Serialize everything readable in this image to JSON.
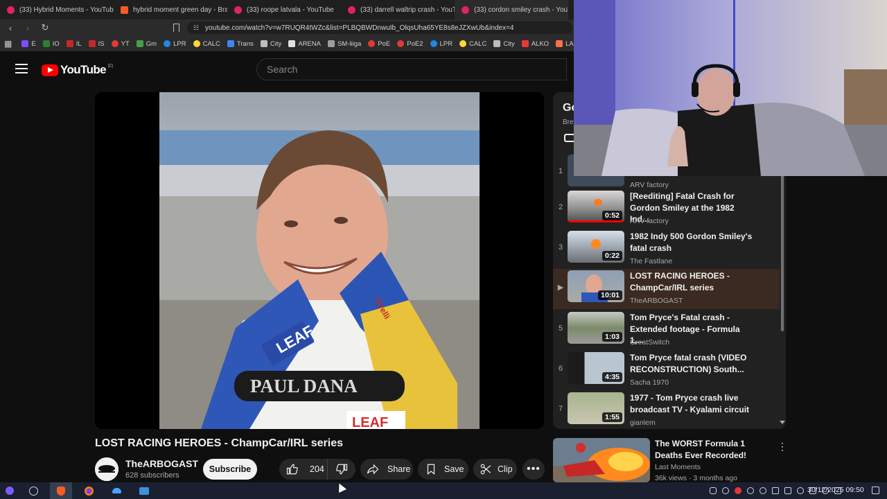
{
  "browser": {
    "tabs": [
      {
        "label": "(33) Hybrid Moments - YouTube",
        "icon": "youtube-favicon"
      },
      {
        "label": "hybrid moment green day - Brav",
        "icon": "brave-favicon"
      },
      {
        "label": "(33) roope latvala - YouTube",
        "icon": "youtube-favicon"
      },
      {
        "label": "(33) darrell waltrip crash - YouTu",
        "icon": "youtube-favicon"
      },
      {
        "label": "(33) cordon smiley crash - YouTu",
        "icon": "youtube-favicon"
      }
    ],
    "url": "youtube.com/watch?v=w7RUQR4tWZc&list=PLBQBWDnwuIb_OlqsUha65YE8s8eJZXwUb&index=4",
    "bookmarks": [
      "E",
      "IO",
      "IL",
      "IS",
      "YT",
      "Gm",
      "LPR",
      "CALC",
      "Trans",
      "City",
      "ARENA",
      "SM-liiga",
      "PoE",
      "PoE2",
      "LPR",
      "CALC",
      "City",
      "ALKO",
      "LA"
    ]
  },
  "youtube": {
    "logo_text": "YouTube",
    "country_code": "FI",
    "search_placeholder": "Search"
  },
  "video": {
    "title": "LOST RACING HEROES - ChampCar/IRL series",
    "overlay_caption": "PAUL DANA",
    "suit_text_1": "LEAF",
    "suit_text_2": "LEAF",
    "suit_text_3": "Pirelli",
    "channel": "TheARBOGAST",
    "subscribers": "628 subscribers",
    "subscribe_label": "Subscribe",
    "likes": "204",
    "share_label": "Share",
    "save_label": "Save",
    "clip_label": "Clip"
  },
  "playlist": {
    "header_partial": "Go",
    "sub_partial": "Bre",
    "items": [
      {
        "index": "1",
        "title": "",
        "channel": "ARV factory",
        "duration": ""
      },
      {
        "index": "2",
        "title": "[Reediting] Fatal Crash for Gordon Smiley at the 1982 Ind...",
        "channel": "ARV factory",
        "duration": "0:52"
      },
      {
        "index": "3",
        "title": "1982 Indy 500 Gordon Smiley's fatal crash",
        "channel": "The Fastlane",
        "duration": "0:22"
      },
      {
        "index": "▶",
        "title": "LOST RACING HEROES - ChampCar/IRL series",
        "channel": "TheARBOGAST",
        "duration": "10:01"
      },
      {
        "index": "5",
        "title": "Tom Pryce's Fatal crash - Extended footage - Formula 1,...",
        "channel": "GreatSwitch",
        "duration": "1:03"
      },
      {
        "index": "6",
        "title": "Tom Pryce fatal crash (VIDEO RECONSTRUCTION) South...",
        "channel": "Sacha 1970",
        "duration": "4:35"
      },
      {
        "index": "7",
        "title": "1977 - Tom Pryce crash live broadcast TV - Kyalami circuit",
        "channel": "gianlem",
        "duration": "1:55"
      }
    ]
  },
  "recommended": {
    "title": "The WORST Formula 1 Deaths Ever Recorded!",
    "channel": "Last Moments",
    "meta": "36k views · 3 months ago"
  },
  "taskbar": {
    "clock": "30/12/2025 09:50"
  }
}
